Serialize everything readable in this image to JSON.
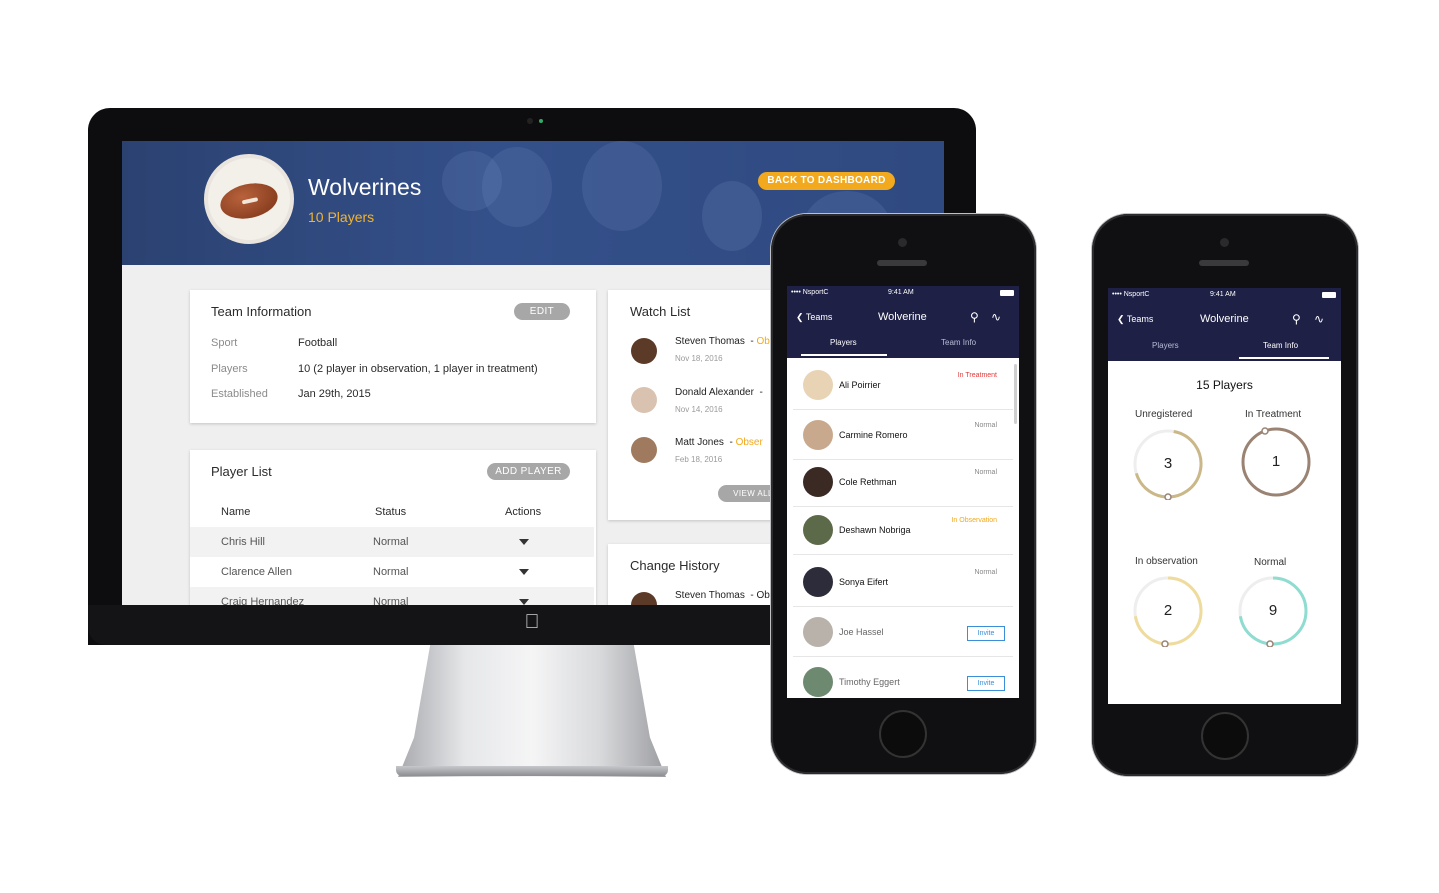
{
  "desktop": {
    "team_name": "Wolverines",
    "team_players": "10 Players",
    "back_button": "BACK TO DASHBOARD",
    "team_info": {
      "title": "Team Information",
      "edit_label": "EDIT",
      "fields": [
        {
          "label": "Sport",
          "value": "Football"
        },
        {
          "label": "Players",
          "value": "10 (2 player in observation, 1 player in treatment)"
        },
        {
          "label": "Established",
          "value": "Jan 29th, 2015"
        }
      ]
    },
    "player_list": {
      "title": "Player List",
      "add_label": "ADD PLAYER",
      "columns": [
        "Name",
        "Status",
        "Actions"
      ],
      "rows": [
        {
          "name": "Chris Hill",
          "status": "Normal"
        },
        {
          "name": "Clarence Allen",
          "status": "Normal"
        },
        {
          "name": "Craig Hernandez",
          "status": "Normal"
        }
      ]
    },
    "watch_list": {
      "title": "Watch List",
      "view_all": "VIEW ALL",
      "items": [
        {
          "name": "Steven Thomas",
          "status": "Ob",
          "date": "Nov 18, 2016"
        },
        {
          "name": "Donald Alexander",
          "status": "",
          "date": "Nov 14, 2016"
        },
        {
          "name": "Matt Jones",
          "status": "Obser",
          "date": "Feb 18, 2016"
        }
      ]
    },
    "change_history": {
      "title": "Change History",
      "items": [
        {
          "name": "Steven Thomas",
          "status": "Ob"
        }
      ]
    }
  },
  "phone1": {
    "carrier": "•••• NsportC",
    "time": "9:41 AM",
    "back": "Teams",
    "title": "Wolverine",
    "tabs": [
      "Players",
      "Team Info"
    ],
    "active_tab": 0,
    "players": [
      {
        "name": "Ali Poirrier",
        "status": "In Treatment",
        "status_color": "#e23b3b"
      },
      {
        "name": "Carmine Romero",
        "status": "Normal",
        "status_color": "#8a8a8a"
      },
      {
        "name": "Cole Rethman",
        "status": "Normal",
        "status_color": "#8a8a8a"
      },
      {
        "name": "Deshawn Nobriga",
        "status": "In Observation",
        "status_color": "#f2a91d"
      },
      {
        "name": "Sonya Eifert",
        "status": "Normal",
        "status_color": "#8a8a8a"
      },
      {
        "name": "Joe Hassel",
        "invite": "Invite"
      },
      {
        "name": "Timothy Eggert",
        "invite": "Invite"
      }
    ]
  },
  "phone2": {
    "carrier": "•••• NsportC",
    "time": "9:41 AM",
    "back": "Teams",
    "title": "Wolverine",
    "tabs": [
      "Players",
      "Team Info"
    ],
    "active_tab": 1,
    "total": "15 Players",
    "stats": [
      {
        "label": "Unregistered",
        "value": "3",
        "color": "#cbb888"
      },
      {
        "label": "In Treatment",
        "value": "1",
        "color": "#9b8374"
      },
      {
        "label": "In observation",
        "value": "2",
        "color": "#efdc9c"
      },
      {
        "label": "Normal",
        "value": "9",
        "color": "#8fdcd0"
      }
    ]
  },
  "colors": {
    "banner": "#2f4a80",
    "accent": "#f2a91d",
    "phone_nav": "#1e2046"
  }
}
